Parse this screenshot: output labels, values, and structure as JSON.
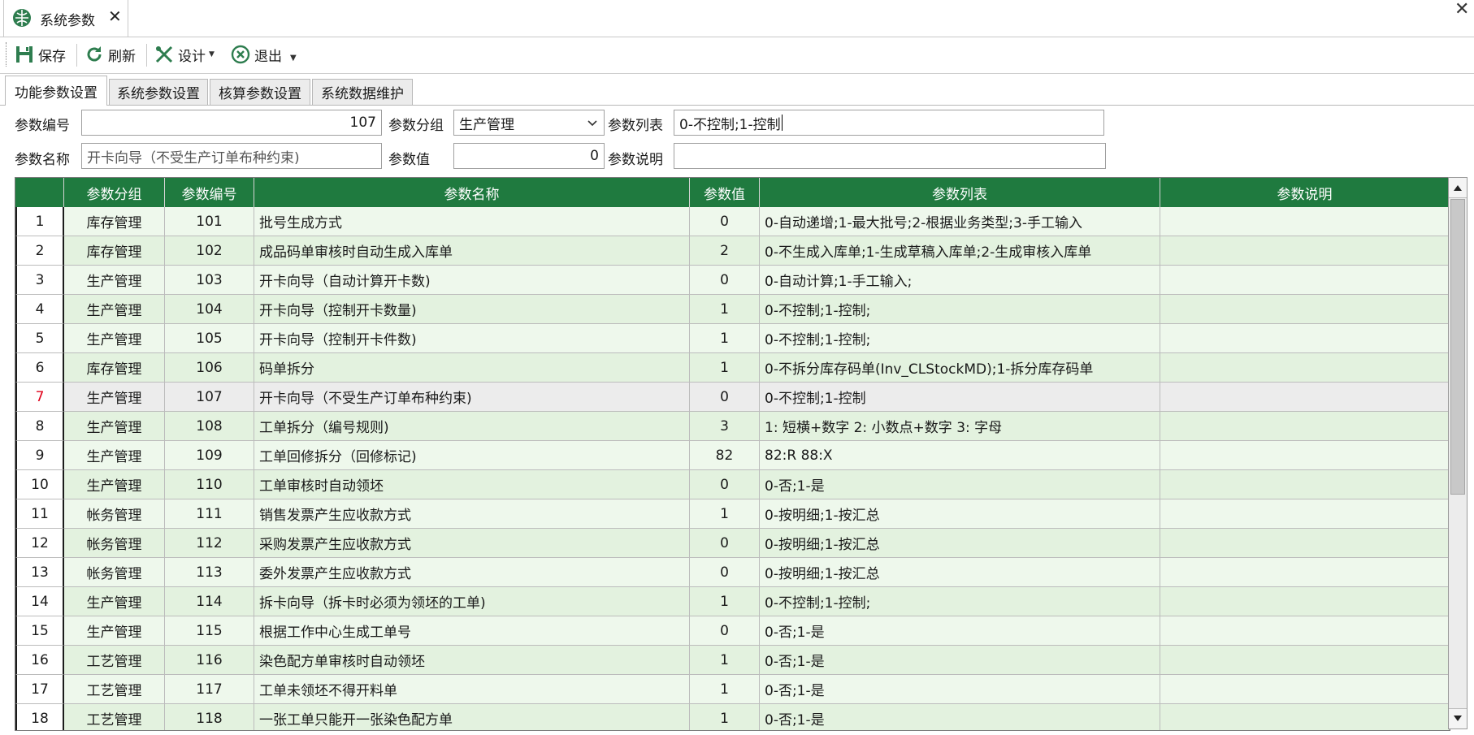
{
  "window": {
    "tab_title": "系统参数",
    "tab_close": "✕",
    "close": "✕",
    "colors": {
      "header_green": "#1f7a3f",
      "row_light": "#eef8ec",
      "row_dark": "#e3f2df",
      "selected_rownum": "#e0001a"
    }
  },
  "toolbar": {
    "save": "保存",
    "refresh": "刷新",
    "design": "设计",
    "exit": "退出",
    "icons": [
      "save-icon",
      "refresh-icon",
      "design-tools-icon",
      "exit-icon"
    ]
  },
  "tabs": [
    "功能参数设置",
    "系统参数设置",
    "核算参数设置",
    "系统数据维护"
  ],
  "form": {
    "param_no_label": "参数编号",
    "param_no_value": "107",
    "param_group_label": "参数分组",
    "param_group_value": "生产管理",
    "param_list_label": "参数列表",
    "param_list_value": "0-不控制;1-控制",
    "param_name_label": "参数名称",
    "param_name_value": "开卡向导（不受生产订单布种约束)",
    "param_value_label": "参数值",
    "param_value_value": "0",
    "param_desc_label": "参数说明",
    "param_desc_value": ""
  },
  "grid": {
    "columns": [
      "参数分组",
      "参数编号",
      "参数名称",
      "参数值",
      "参数列表",
      "参数说明"
    ],
    "selected_row": 7,
    "rows": [
      {
        "n": "1",
        "group": "库存管理",
        "code": "101",
        "name": "批号生成方式",
        "value": "0",
        "list": "0-自动递增;1-最大批号;2-根据业务类型;3-手工输入",
        "desc": ""
      },
      {
        "n": "2",
        "group": "库存管理",
        "code": "102",
        "name": "成品码单审核时自动生成入库单",
        "value": "2",
        "list": "0-不生成入库单;1-生成草稿入库单;2-生成审核入库单",
        "desc": ""
      },
      {
        "n": "3",
        "group": "生产管理",
        "code": "103",
        "name": "开卡向导（自动计算开卡数)",
        "value": "0",
        "list": "0-自动计算;1-手工输入;",
        "desc": ""
      },
      {
        "n": "4",
        "group": "生产管理",
        "code": "104",
        "name": "开卡向导（控制开卡数量)",
        "value": "1",
        "list": "0-不控制;1-控制;",
        "desc": ""
      },
      {
        "n": "5",
        "group": "生产管理",
        "code": "105",
        "name": "开卡向导（控制开卡件数)",
        "value": "1",
        "list": "0-不控制;1-控制;",
        "desc": ""
      },
      {
        "n": "6",
        "group": "库存管理",
        "code": "106",
        "name": "码单拆分",
        "value": "1",
        "list": "0-不拆分库存码单(Inv_CLStockMD);1-拆分库存码单",
        "desc": ""
      },
      {
        "n": "7",
        "group": "生产管理",
        "code": "107",
        "name": "开卡向导（不受生产订单布种约束)",
        "value": "0",
        "list": "0-不控制;1-控制",
        "desc": ""
      },
      {
        "n": "8",
        "group": "生产管理",
        "code": "108",
        "name": "工单拆分（编号规则)",
        "value": "3",
        "list": "1: 短横+数字  2: 小数点+数字 3: 字母",
        "desc": ""
      },
      {
        "n": "9",
        "group": "生产管理",
        "code": "109",
        "name": "工单回修拆分（回修标记)",
        "value": "82",
        "list": "82:R 88:X",
        "desc": ""
      },
      {
        "n": "10",
        "group": "生产管理",
        "code": "110",
        "name": "工单审核时自动领坯",
        "value": "0",
        "list": "0-否;1-是",
        "desc": ""
      },
      {
        "n": "11",
        "group": "帐务管理",
        "code": "111",
        "name": "销售发票产生应收款方式",
        "value": "1",
        "list": "0-按明细;1-按汇总",
        "desc": ""
      },
      {
        "n": "12",
        "group": "帐务管理",
        "code": "112",
        "name": "采购发票产生应收款方式",
        "value": "0",
        "list": "0-按明细;1-按汇总",
        "desc": ""
      },
      {
        "n": "13",
        "group": "帐务管理",
        "code": "113",
        "name": "委外发票产生应收款方式",
        "value": "0",
        "list": "0-按明细;1-按汇总",
        "desc": ""
      },
      {
        "n": "14",
        "group": "生产管理",
        "code": "114",
        "name": "拆卡向导（拆卡时必须为领坯的工单)",
        "value": "1",
        "list": "0-不控制;1-控制;",
        "desc": ""
      },
      {
        "n": "15",
        "group": "生产管理",
        "code": "115",
        "name": "根据工作中心生成工单号",
        "value": "0",
        "list": "0-否;1-是",
        "desc": ""
      },
      {
        "n": "16",
        "group": "工艺管理",
        "code": "116",
        "name": "染色配方单审核时自动领坯",
        "value": "1",
        "list": "0-否;1-是",
        "desc": ""
      },
      {
        "n": "17",
        "group": "工艺管理",
        "code": "117",
        "name": "工单未领坯不得开料单",
        "value": "1",
        "list": "0-否;1-是",
        "desc": ""
      },
      {
        "n": "18",
        "group": "工艺管理",
        "code": "118",
        "name": "一张工单只能开一张染色配方单",
        "value": "1",
        "list": "0-否;1-是",
        "desc": ""
      }
    ]
  }
}
